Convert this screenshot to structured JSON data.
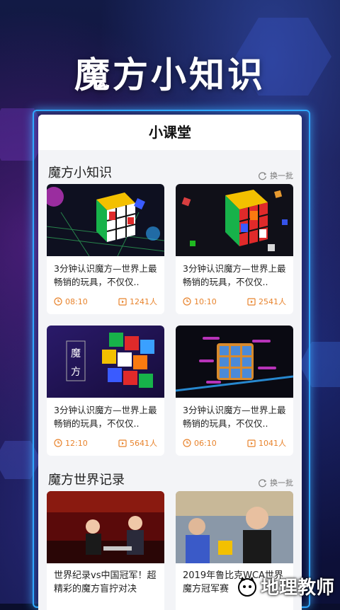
{
  "headline": "魔方小知识",
  "panel": {
    "title": "小课堂"
  },
  "section1": {
    "title": "魔方小知识",
    "refresh_label": "换一批",
    "cards": [
      {
        "title": "3分钟认识魔方—世界上最畅销的玩具，不仅仅..",
        "duration": "08:10",
        "viewers": "1241人"
      },
      {
        "title": "3分钟认识魔方—世界上最畅销的玩具，不仅仅..",
        "duration": "10:10",
        "viewers": "2541人"
      },
      {
        "title": "3分钟认识魔方—世界上最畅销的玩具，不仅仅..",
        "duration": "12:10",
        "viewers": "5641人",
        "thumb_text_1": "魔",
        "thumb_text_2": "方"
      },
      {
        "title": "3分钟认识魔方—世界上最畅销的玩具，不仅仅..",
        "duration": "06:10",
        "viewers": "1041人"
      }
    ]
  },
  "section2": {
    "title": "魔方世界记录",
    "refresh_label": "换一批",
    "cards": [
      {
        "title": "世界纪录vs中国冠军！超精彩的魔方盲拧对决"
      },
      {
        "title": "2019年鲁比克WCA世界魔方冠军赛"
      }
    ]
  },
  "watermark": "地理教师",
  "colors": {
    "accent": "#e8832c",
    "frame": "#2fa8ff"
  }
}
